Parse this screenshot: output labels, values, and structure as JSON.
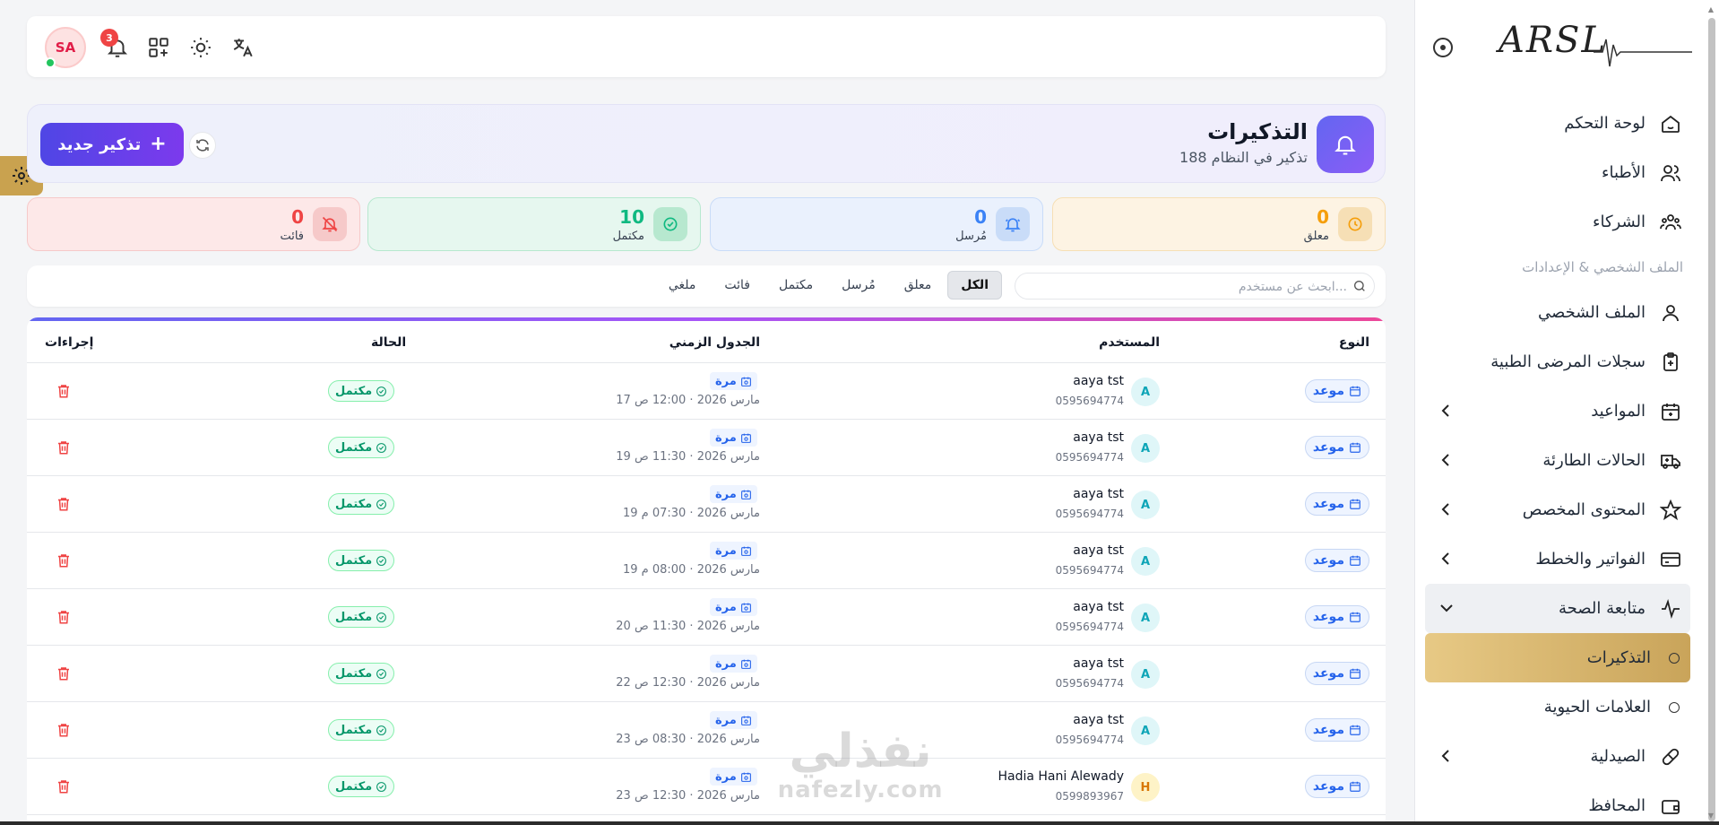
{
  "app": {
    "logo_text": "ARSL",
    "colors": {
      "brand": "#6366f1",
      "gold": "#c9a24f"
    }
  },
  "sidebar": {
    "items": [
      {
        "label": "لوحة التحكم",
        "icon": "home-icon"
      },
      {
        "label": "الأطباء",
        "icon": "users-icon"
      },
      {
        "label": "الشركاء",
        "icon": "partners-icon"
      }
    ],
    "section_label": "الملف الشخصي & الإعدادات",
    "items2": [
      {
        "label": "الملف الشخصي",
        "icon": "user-icon"
      },
      {
        "label": "سجلات المرضى الطبية",
        "icon": "clipboard-icon"
      },
      {
        "label": "المواعيد",
        "icon": "calendar-icon"
      },
      {
        "label": "الحالات الطارئة",
        "icon": "ambulance-icon"
      },
      {
        "label": "المحتوى المخصص",
        "icon": "star-icon"
      },
      {
        "label": "الفواتير والخطط",
        "icon": "card-icon"
      },
      {
        "label": "متابعة الصحة",
        "icon": "pulse-icon"
      }
    ],
    "sub_items": [
      {
        "label": "التذكيرات"
      },
      {
        "label": "العلامات الحيوية"
      }
    ],
    "items3": [
      {
        "label": "الصيدلية",
        "icon": "pill-icon"
      },
      {
        "label": "المحافظ",
        "icon": "wallet-icon"
      }
    ]
  },
  "topbar": {
    "avatar_initials": "SA",
    "notification_count": "3"
  },
  "header": {
    "title": "التذكيرات",
    "subtitle": "188 تذكير في النظام",
    "new_button": "تذكير جديد"
  },
  "stats": [
    {
      "value": "0",
      "label": "معلق",
      "color": "#f59e0b",
      "bg": "#fdf3e3",
      "border": "#f6dfb5",
      "icon": "clock-icon"
    },
    {
      "value": "0",
      "label": "مُرسل",
      "color": "#3b82f6",
      "bg": "#eaf1fd",
      "border": "#c9dcf8",
      "icon": "bell-ring-icon"
    },
    {
      "value": "10",
      "label": "مكتمل",
      "color": "#10b981",
      "bg": "#e6f7ef",
      "border": "#b7e8cf",
      "icon": "check-circle-icon"
    },
    {
      "value": "0",
      "label": "فائت",
      "color": "#ef4444",
      "bg": "#fde8e8",
      "border": "#f6c9c9",
      "icon": "bell-off-icon"
    }
  ],
  "filters": {
    "search_placeholder": "ابحث عن مستخدم...",
    "tabs": [
      "الكل",
      "معلق",
      "مُرسل",
      "مكتمل",
      "فائت",
      "ملغي"
    ]
  },
  "table": {
    "headers": {
      "type": "النوع",
      "user": "المستخدم",
      "schedule": "الجدول الزمني",
      "status": "الحالة",
      "actions": "إجراءات"
    },
    "rows": [
      {
        "type": "موعد",
        "initial": "A",
        "name": "aaya tst",
        "phone": "0595694774",
        "freq": "مرة",
        "when": "17 مارس 2026 · 12:00 ص",
        "status": "مكتمل"
      },
      {
        "type": "موعد",
        "initial": "A",
        "name": "aaya tst",
        "phone": "0595694774",
        "freq": "مرة",
        "when": "19 مارس 2026 · 11:30 ص",
        "status": "مكتمل"
      },
      {
        "type": "موعد",
        "initial": "A",
        "name": "aaya tst",
        "phone": "0595694774",
        "freq": "مرة",
        "when": "19 مارس 2026 · 07:30 م",
        "status": "مكتمل"
      },
      {
        "type": "موعد",
        "initial": "A",
        "name": "aaya tst",
        "phone": "0595694774",
        "freq": "مرة",
        "when": "19 مارس 2026 · 08:00 م",
        "status": "مكتمل"
      },
      {
        "type": "موعد",
        "initial": "A",
        "name": "aaya tst",
        "phone": "0595694774",
        "freq": "مرة",
        "when": "20 مارس 2026 · 11:30 ص",
        "status": "مكتمل"
      },
      {
        "type": "موعد",
        "initial": "A",
        "name": "aaya tst",
        "phone": "0595694774",
        "freq": "مرة",
        "when": "22 مارس 2026 · 12:30 ص",
        "status": "مكتمل"
      },
      {
        "type": "موعد",
        "initial": "A",
        "name": "aaya tst",
        "phone": "0595694774",
        "freq": "مرة",
        "when": "23 مارس 2026 · 08:30 ص",
        "status": "مكتمل"
      },
      {
        "type": "موعد",
        "initial": "H",
        "name": "Hadia Hani Alewady",
        "phone": "0599893967",
        "freq": "مرة",
        "when": "23 مارس 2026 · 12:30 ص",
        "status": "مكتمل"
      }
    ]
  },
  "watermark": {
    "line1": "نفذلي",
    "line2": "nafezly.com"
  }
}
